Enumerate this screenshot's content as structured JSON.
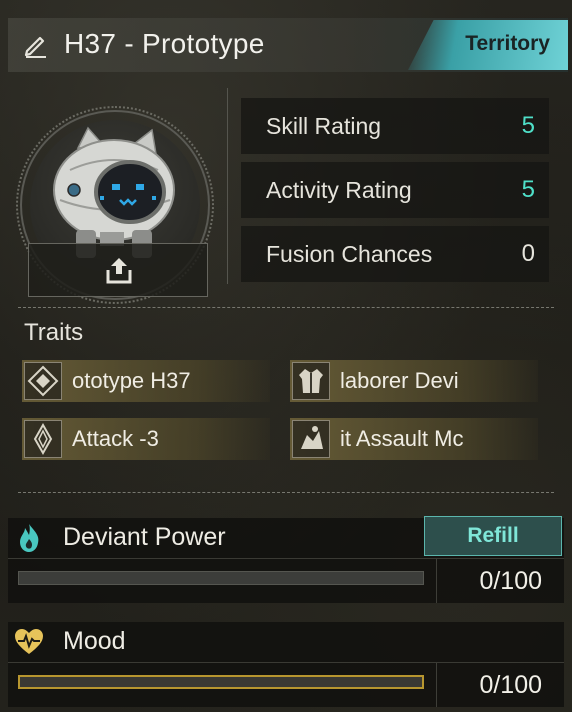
{
  "header": {
    "title": "H37 - Prototype",
    "badge": "Territory",
    "icon": "pencil-edit-icon"
  },
  "portrait": {
    "subject": "robot-pig-deviant",
    "upload_icon": "upload-icon"
  },
  "stats": [
    {
      "label": "Skill Rating",
      "value": "5",
      "color": "#4fe0c9"
    },
    {
      "label": "Activity Rating",
      "value": "5",
      "color": "#4fe0c9"
    },
    {
      "label": "Fusion Chances",
      "value": "0",
      "color": "#e6e4dc"
    }
  ],
  "traits": {
    "title": "Traits",
    "items": [
      {
        "text": "ototype   H37",
        "icon": "diamond-icon"
      },
      {
        "text": "laborer   Devi",
        "icon": "coat-icon"
      },
      {
        "text": "Attack -3",
        "icon": "crystal-icon"
      },
      {
        "text": "it Assault   Mc",
        "icon": "assault-icon"
      }
    ]
  },
  "deviant_power": {
    "label": "Deviant Power",
    "icon": "flame-icon",
    "refill_label": "Refill",
    "count": "0/100",
    "level": 0
  },
  "mood": {
    "label": "Mood",
    "icon": "heart-pulse-icon",
    "count": "0/100",
    "level": 0
  },
  "colors": {
    "accent_teal": "#4fe0c9",
    "territory_teal": "#6fd2d6",
    "mood_gold": "#b7962f"
  }
}
